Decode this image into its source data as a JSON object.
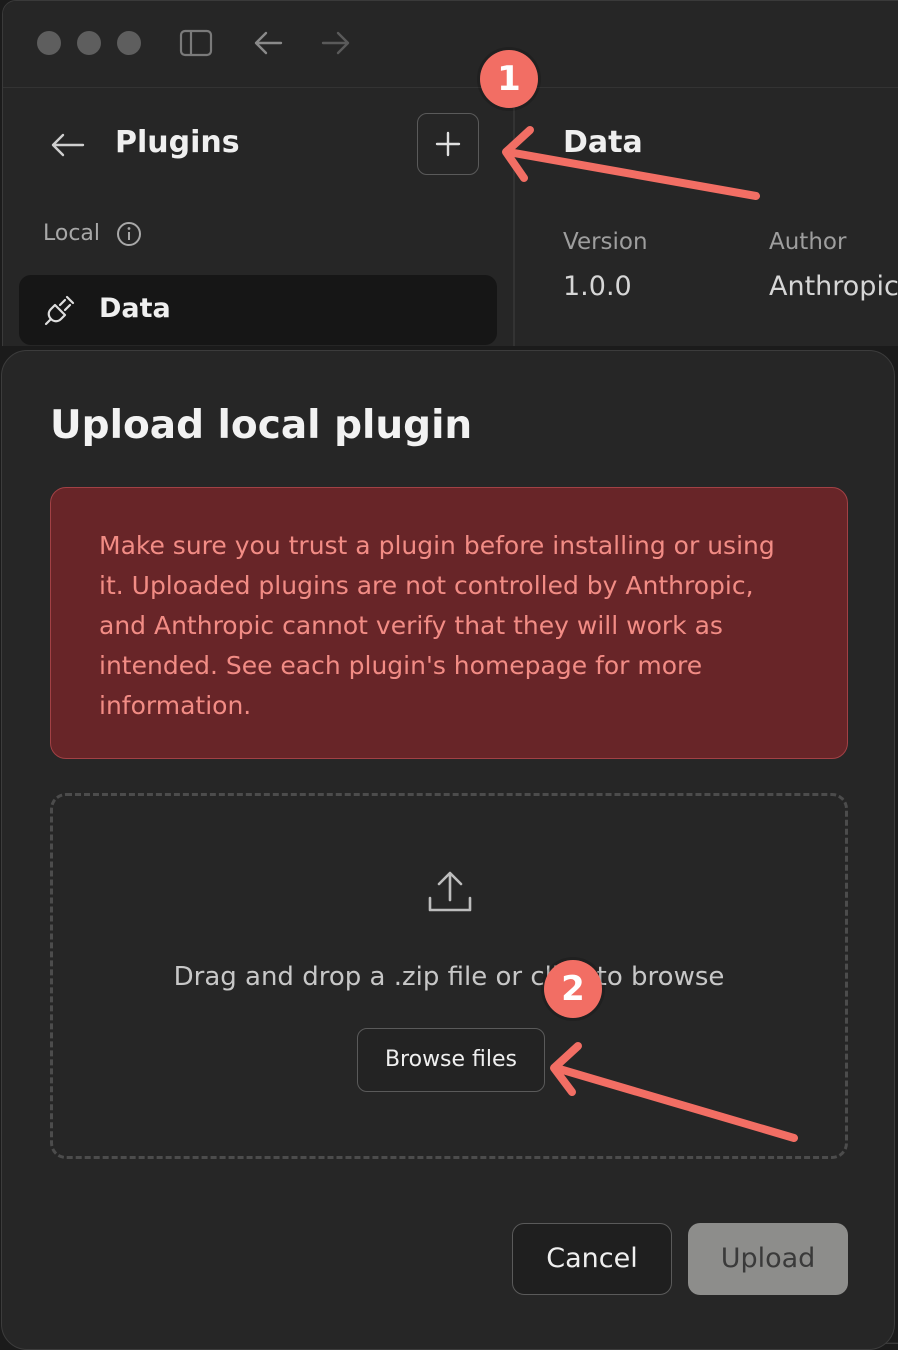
{
  "sidebar": {
    "title": "Plugins",
    "section_label": "Local",
    "items": [
      {
        "label": "Data",
        "icon": "plug-icon",
        "selected": true
      }
    ]
  },
  "detail": {
    "title": "Data",
    "version_label": "Version",
    "version_value": "1.0.0",
    "author_label": "Author",
    "author_value": "Anthropic"
  },
  "modal": {
    "title": "Upload local plugin",
    "warning": "Make sure you trust a plugin before installing or using it. Uploaded plugins are not controlled by Anthropic, and Anthropic cannot verify that they will work as intended. See each plugin's homepage for more information.",
    "dropzone_text": "Drag and drop a .zip file or click to browse",
    "browse_label": "Browse files",
    "cancel_label": "Cancel",
    "upload_label": "Upload",
    "upload_enabled": false
  },
  "annotations": {
    "step1": "1",
    "step2": "2"
  },
  "colors": {
    "background": "#262626",
    "warning_bg": "#682528",
    "warning_text": "#f28c85",
    "annotation": "#f26e64",
    "upload_disabled": "#8d8d8b"
  }
}
